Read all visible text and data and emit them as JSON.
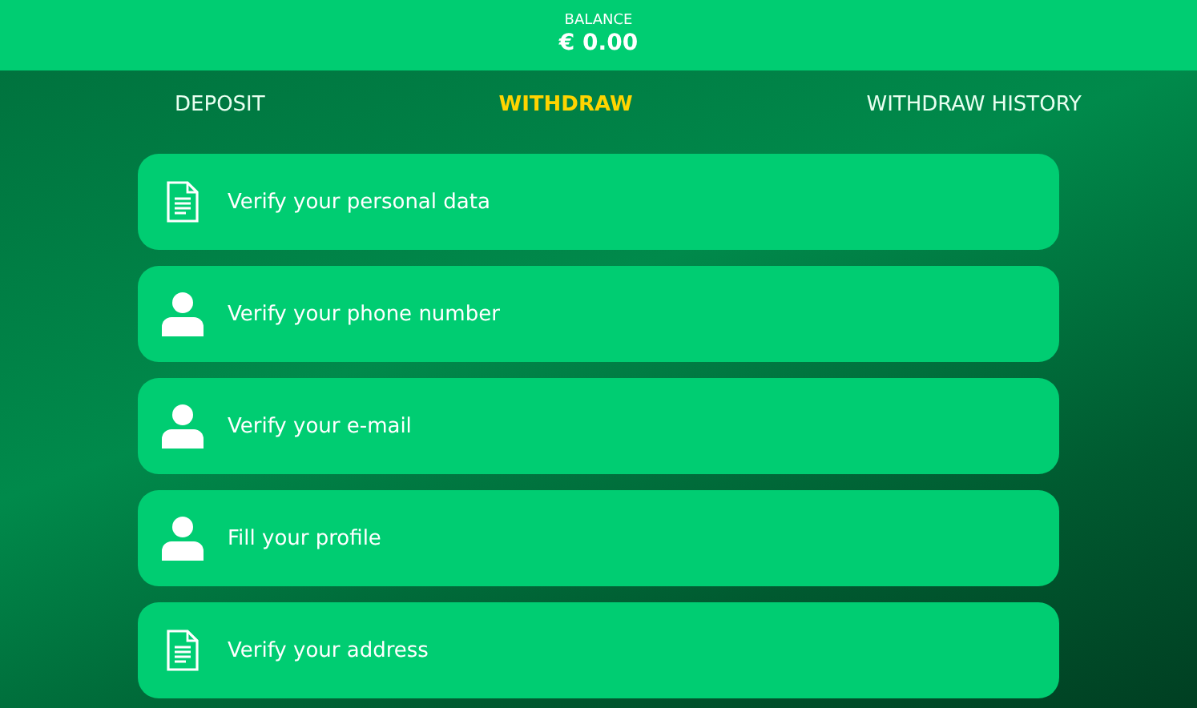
{
  "balance": {
    "label": "BALANCE",
    "amount": "€ 0.00"
  },
  "tabs": [
    {
      "label": "DEPOSIT",
      "selected": false
    },
    {
      "label": "WITHDRAW",
      "selected": true
    },
    {
      "label": "WITHDRAW HISTORY",
      "selected": false
    }
  ],
  "steps": [
    {
      "kind": "document",
      "label": "Verify your personal data"
    },
    {
      "kind": "person",
      "label": "Verify your phone number"
    },
    {
      "kind": "person",
      "label": "Verify your e-mail"
    },
    {
      "kind": "person",
      "label": "Fill your profile"
    },
    {
      "kind": "document",
      "label": "Verify your address"
    }
  ]
}
